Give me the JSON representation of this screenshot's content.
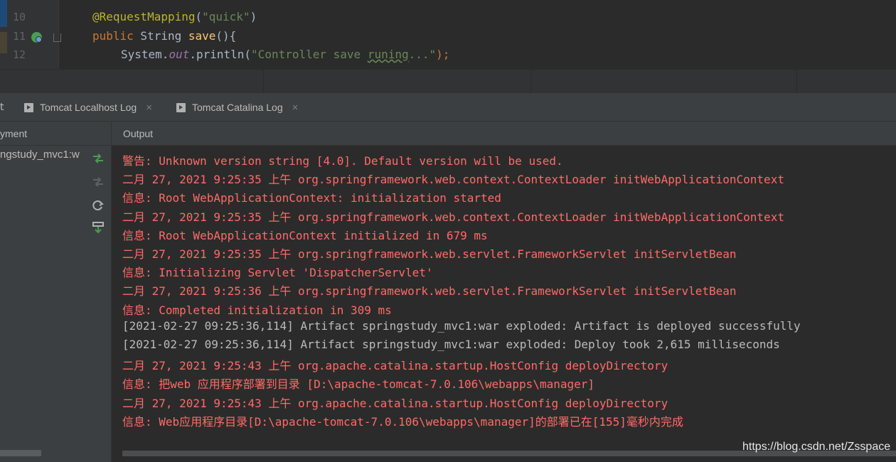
{
  "editor": {
    "line_numbers": [
      "10",
      "11",
      "12"
    ],
    "lines": {
      "l10": {
        "annotation": "@RequestMapping",
        "open": "(",
        "arg": "\"quick\"",
        "close": ")"
      },
      "l11": {
        "kw": "public",
        "type": " String ",
        "fn": "save",
        "rest": "(){"
      },
      "l12": {
        "cls": "System.",
        "field": "out",
        "call": ".println(",
        "str_pre": "\"Controller save ",
        "str_typo": "runing",
        "str_post": "...\"",
        "end": ");"
      }
    }
  },
  "tabs": [
    {
      "label": "Tomcat Localhost Log",
      "icon": "console-tab-icon"
    },
    {
      "label": "Tomcat Catalina Log",
      "icon": "console-tab-icon"
    }
  ],
  "tab_close_glyph": "×",
  "tab_stub": "t",
  "left_panel": {
    "header": "yment",
    "deployment_item": "ngstudy_mvc1:w"
  },
  "output": {
    "header": "Output",
    "lines": [
      {
        "text": "警告: Unknown version string [4.0]. Default version will be used.",
        "level": "err"
      },
      {
        "text": "二月 27, 2021 9:25:35 上午 org.springframework.web.context.ContextLoader initWebApplicationContext",
        "level": "err"
      },
      {
        "text": "信息: Root WebApplicationContext: initialization started",
        "level": "err"
      },
      {
        "text": "二月 27, 2021 9:25:35 上午 org.springframework.web.context.ContextLoader initWebApplicationContext",
        "level": "err"
      },
      {
        "text": "信息: Root WebApplicationContext initialized in 679 ms",
        "level": "err"
      },
      {
        "text": "二月 27, 2021 9:25:35 上午 org.springframework.web.servlet.FrameworkServlet initServletBean",
        "level": "err"
      },
      {
        "text": "信息: Initializing Servlet 'DispatcherServlet'",
        "level": "err"
      },
      {
        "text": "二月 27, 2021 9:25:36 上午 org.springframework.web.servlet.FrameworkServlet initServletBean",
        "level": "err"
      },
      {
        "text": "信息: Completed initialization in 309 ms",
        "level": "err"
      },
      {
        "text": "[2021-02-27 09:25:36,114] Artifact springstudy_mvc1:war exploded: Artifact is deployed successfully",
        "level": "info"
      },
      {
        "text": "[2021-02-27 09:25:36,114] Artifact springstudy_mvc1:war exploded: Deploy took 2,615 milliseconds",
        "level": "info"
      },
      {
        "text": "二月 27, 2021 9:25:43 上午 org.apache.catalina.startup.HostConfig deployDirectory",
        "level": "err"
      },
      {
        "text": "信息: 把web 应用程序部署到目录 [D:\\apache-tomcat-7.0.106\\webapps\\manager]",
        "level": "err"
      },
      {
        "text": "二月 27, 2021 9:25:43 上午 org.apache.catalina.startup.HostConfig deployDirectory",
        "level": "err"
      },
      {
        "text": "信息: Web应用程序目录[D:\\apache-tomcat-7.0.106\\webapps\\manager]的部署已在[155]毫秒内完成",
        "level": "err"
      }
    ]
  },
  "colors": {
    "error_text": "#ff6b68",
    "info_text": "#bbbbbb",
    "run_green": "#499c54"
  },
  "watermark": "https://blog.csdn.net/Zsspace"
}
